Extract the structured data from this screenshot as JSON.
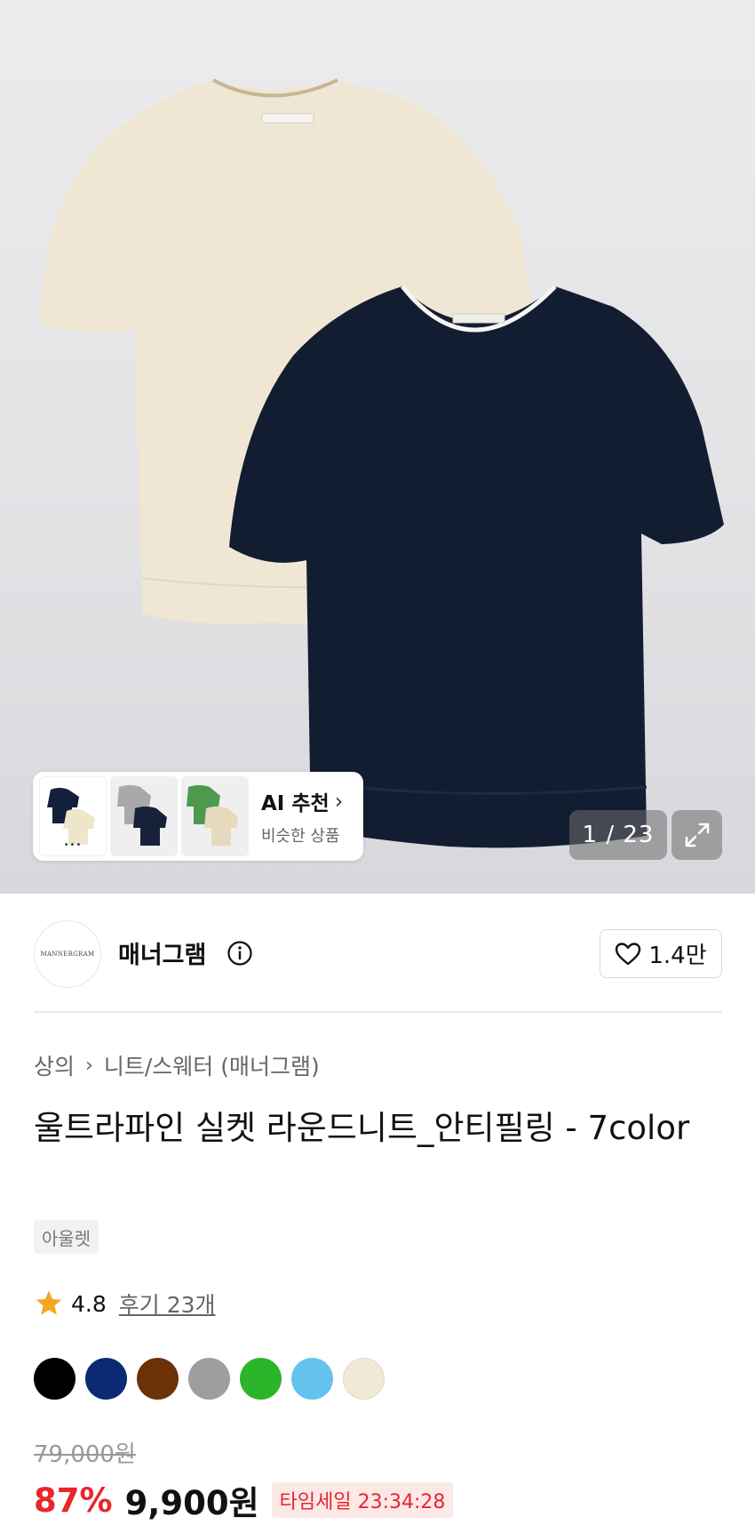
{
  "gallery": {
    "counter": "1 / 23",
    "ai_card": {
      "title": "AI 추천",
      "subtitle": "비슷한 상품",
      "thumb_dots": "•••"
    }
  },
  "brand": {
    "name": "매너그램",
    "logo_text": "MANNERGRAM",
    "like_count": "1.4만"
  },
  "product": {
    "breadcrumb": [
      "상의",
      "니트/스웨터 (매너그램)"
    ],
    "title": "울트라파인 실켓 라운드니트_안티필링 - 7color",
    "tag": "아울렛",
    "rating": "4.8",
    "reviews": "후기 23개",
    "colors": [
      "#000000",
      "#0b2a73",
      "#6b3208",
      "#9e9e9e",
      "#2cb52a",
      "#63c3ee",
      "#efe9d6"
    ],
    "original_price": "79,000원",
    "discount": "87%",
    "price": "9,900원",
    "timesale": "타임세일 23:34:28"
  },
  "icons": {
    "info": "info-icon",
    "heart": "heart-icon",
    "star": "star-icon",
    "expand": "expand-icon",
    "chevron": "chevron-right-icon"
  },
  "theme": {
    "accent_red": "#e8262b",
    "star_color": "#f5a623"
  }
}
